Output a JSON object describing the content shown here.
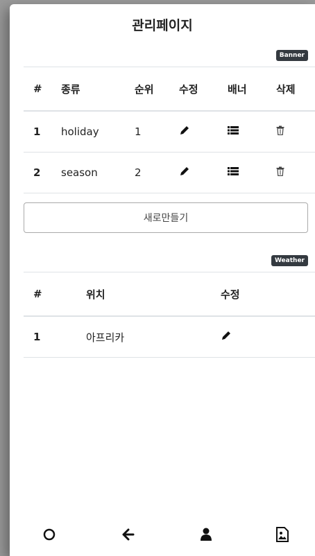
{
  "page": {
    "title": "관리페이지"
  },
  "banner_section": {
    "badge": "Banner",
    "columns": [
      "#",
      "종류",
      "순위",
      "수정",
      "배너",
      "삭제"
    ],
    "rows": [
      {
        "num": "1",
        "kind": "holiday",
        "rank": "1"
      },
      {
        "num": "2",
        "kind": "season",
        "rank": "2"
      }
    ],
    "new_button": "새로만들기"
  },
  "weather_section": {
    "badge": "Weather",
    "columns": [
      "#",
      "위치",
      "수정"
    ],
    "rows": [
      {
        "num": "1",
        "location": "아프리카"
      }
    ]
  },
  "icons": {
    "edit": "pencil-icon",
    "banner": "list-icon",
    "delete": "trash-icon",
    "nav": [
      "circle-icon",
      "arrow-left-icon",
      "user-icon",
      "image-file-icon"
    ]
  },
  "colors": {
    "badge_bg": "#343a40",
    "text": "#222222",
    "border": "#dee2e6"
  }
}
